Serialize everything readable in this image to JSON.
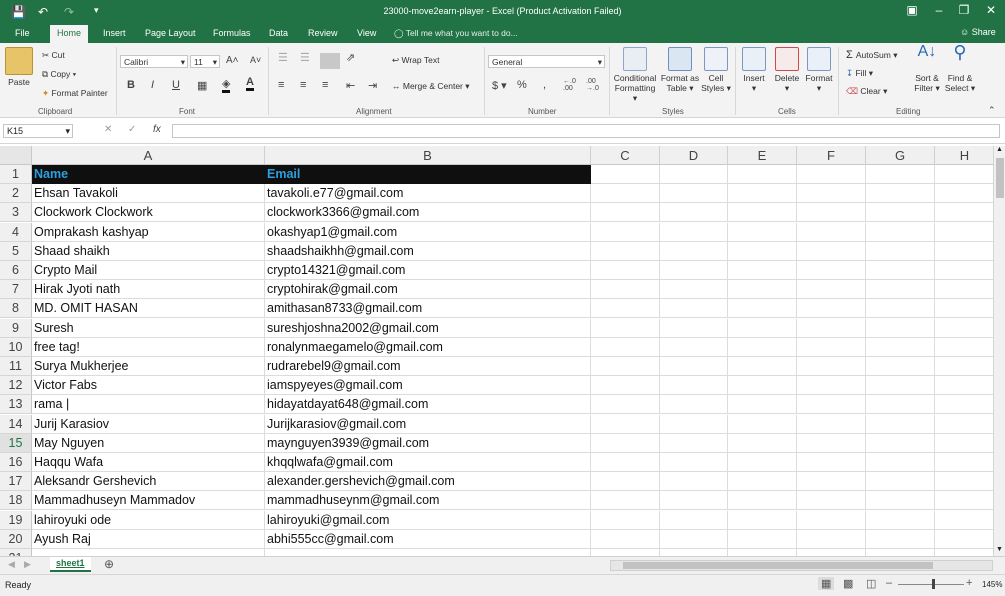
{
  "window": {
    "title": "23000-move2earn-player - Excel (Product Activation Failed)"
  },
  "ribbon_tabs": [
    {
      "label": "File"
    },
    {
      "label": "Home"
    },
    {
      "label": "Insert"
    },
    {
      "label": "Page Layout"
    },
    {
      "label": "Formulas"
    },
    {
      "label": "Data"
    },
    {
      "label": "Review"
    },
    {
      "label": "View"
    }
  ],
  "tell_me": "Tell me what you want to do...",
  "share": "Share",
  "clipboard": {
    "paste": "Paste",
    "cut": "Cut",
    "copy": "Copy",
    "format_painter": "Format Painter",
    "group": "Clipboard"
  },
  "font": {
    "name": "Calibri",
    "size": "11",
    "group": "Font"
  },
  "alignment": {
    "wrap": "Wrap Text",
    "merge": "Merge & Center",
    "group": "Alignment"
  },
  "number": {
    "format": "General",
    "group": "Number"
  },
  "styles": {
    "conditional": "Conditional",
    "conditional2": "Formatting",
    "format_as": "Format as",
    "table": "Table",
    "cell": "Cell",
    "styles": "Styles",
    "group": "Styles"
  },
  "cells": {
    "insert": "Insert",
    "delete": "Delete",
    "format": "Format",
    "group": "Cells"
  },
  "editing": {
    "autosum": "AutoSum",
    "fill": "Fill",
    "clear": "Clear",
    "sort": "Sort &",
    "filter": "Filter",
    "find": "Find &",
    "select": "Select",
    "group": "Editing"
  },
  "formula_bar": {
    "name_box": "K15",
    "fx": "fx",
    "content": ""
  },
  "columns": [
    "A",
    "B",
    "C",
    "D",
    "E",
    "F",
    "G",
    "H"
  ],
  "rows": [
    {
      "num": "1",
      "a": "Name",
      "b": "Email"
    },
    {
      "num": "2",
      "a": "Ehsan Tavakoli",
      "b": "tavakoli.e77@gmail.com"
    },
    {
      "num": "3",
      "a": "Clockwork Clockwork",
      "b": "clockwork3366@gmail.com"
    },
    {
      "num": "4",
      "a": "Omprakash kashyap",
      "b": "okashyap1@gmail.com"
    },
    {
      "num": "5",
      "a": "Shaad shaikh",
      "b": "shaadshaikhh@gmail.com"
    },
    {
      "num": "6",
      "a": "Crypto Mail",
      "b": "crypto14321@gmail.com"
    },
    {
      "num": "7",
      "a": "Hirak Jyoti nath",
      "b": "cryptohirak@gmail.com"
    },
    {
      "num": "8",
      "a": "MD. OMIT HASAN",
      "b": "amithasan8733@gmail.com"
    },
    {
      "num": "9",
      "a": "Suresh",
      "b": "sureshjoshna2002@gmail.com"
    },
    {
      "num": "10",
      "a": "free tag!",
      "b": "ronalynmaegamelo@gmail.com"
    },
    {
      "num": "11",
      "a": "Surya Mukherjee",
      "b": "rudrarebel9@gmail.com"
    },
    {
      "num": "12",
      "a": "Victor Fabs",
      "b": "iamspyeyes@gmail.com"
    },
    {
      "num": "13",
      "a": "rama |",
      "b": "hidayatdayat648@gmail.com"
    },
    {
      "num": "14",
      "a": "Jurij Karasiov",
      "b": "Jurijkarasiov@gmail.com"
    },
    {
      "num": "15",
      "a": "May Nguyen",
      "b": "maynguyen3939@gmail.com"
    },
    {
      "num": "16",
      "a": "Haqqu Wafa",
      "b": "khqqlwafa@gmail.com"
    },
    {
      "num": "17",
      "a": "Aleksandr Gershevich",
      "b": "alexander.gershevich@gmail.com"
    },
    {
      "num": "18",
      "a": "Mammadhuseyn Mammadov",
      "b": "mammadhuseynm@gmail.com"
    },
    {
      "num": "19",
      "a": "lahiroyuki ode",
      "b": "lahiroyuki@gmail.com"
    },
    {
      "num": "20",
      "a": "Ayush Raj",
      "b": "abhi555cc@gmail.com"
    },
    {
      "num": "21",
      "a": "",
      "b": ""
    }
  ],
  "sheet_tab": "sheet1",
  "status": {
    "ready": "Ready",
    "zoom": "145%"
  },
  "colors": {
    "accent": "#217346",
    "header_bg": "#0f0f0f",
    "header_text": "#2c9fe0"
  }
}
